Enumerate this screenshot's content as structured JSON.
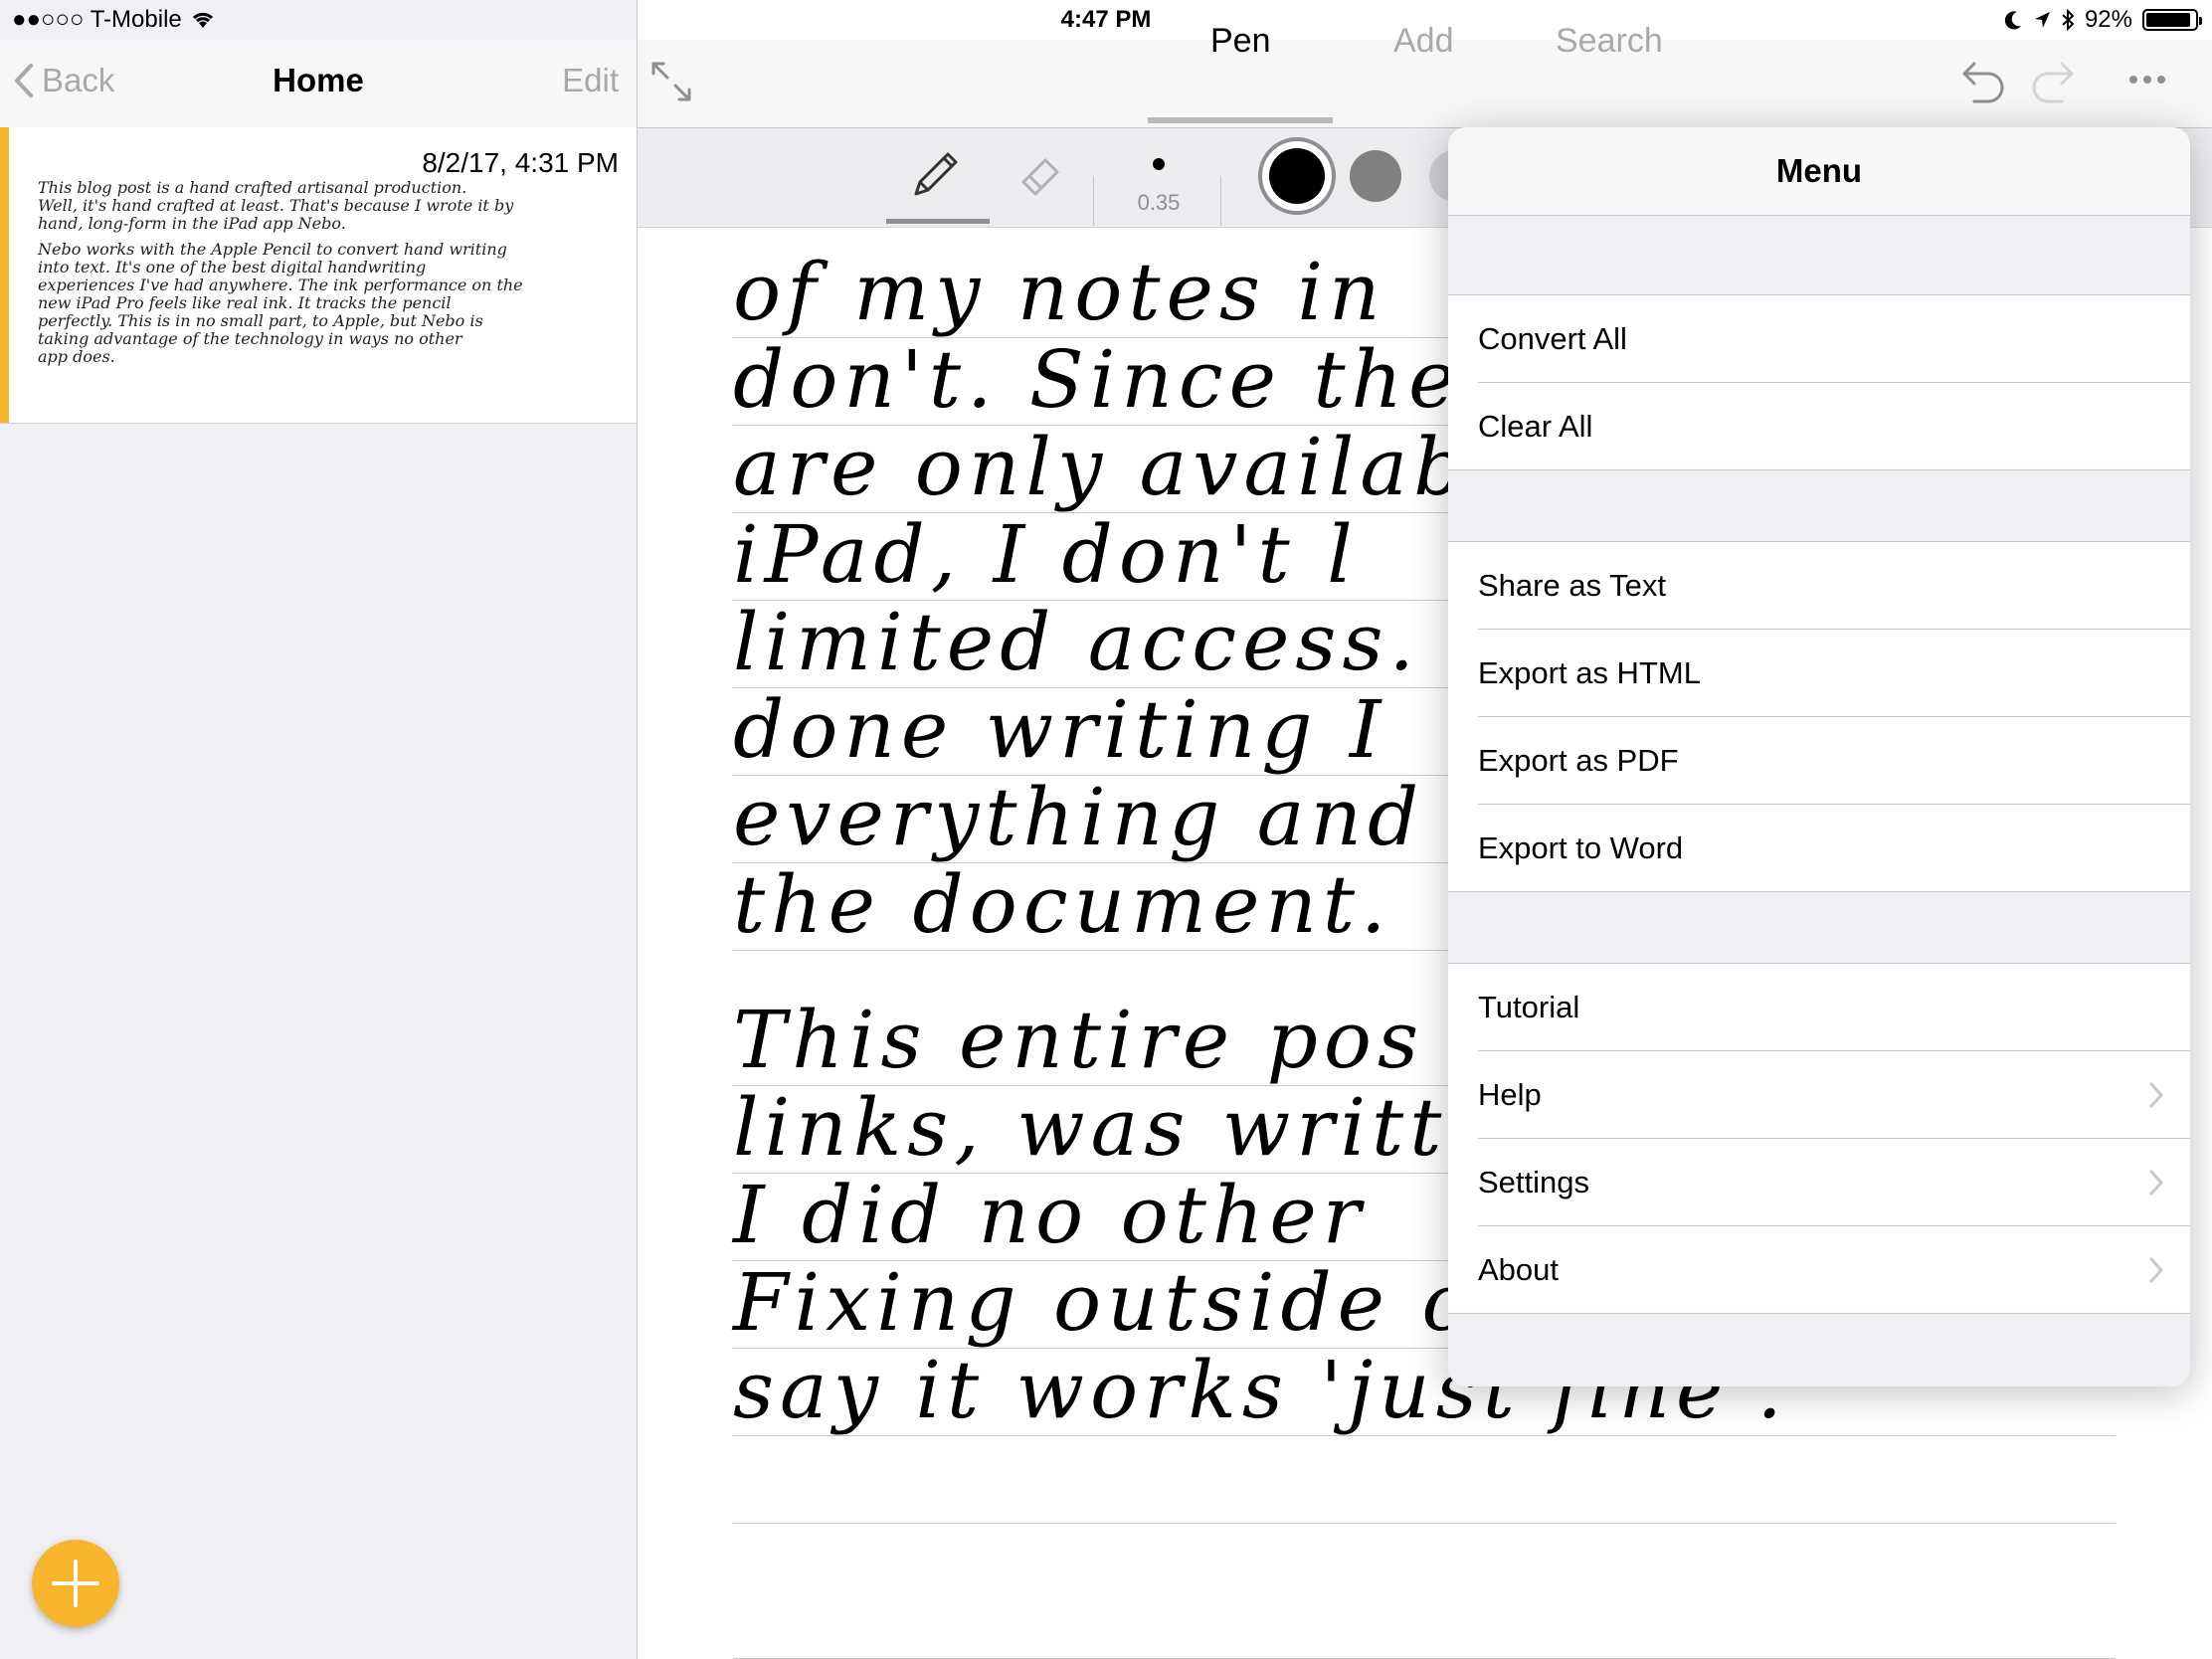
{
  "status_bar": {
    "carrier": "●●○○○ T-Mobile",
    "time": "4:47 PM",
    "battery": "92%",
    "battery_level": 0.92
  },
  "sidebar": {
    "back_label": "Back",
    "title": "Home",
    "edit_label": "Edit",
    "notes": [
      {
        "date": "8/2/17, 4:31 PM",
        "preview_lines": [
          "This blog post is a hand crafted artisanal production.",
          "Well, it's hand crafted at least. That's because I wrote it by",
          "hand, long-form in the iPad app Nebo.",
          "Nebo works with the Apple Pencil to convert hand writing",
          "into text. It's one of the best digital handwriting",
          "experiences I've had anywhere. The ink performance on the",
          "new iPad Pro feels like real ink. It tracks the pencil",
          "perfectly. This is in no small part, to Apple, but Nebo is",
          "taking advantage of the technology in ways no other",
          "app does."
        ]
      }
    ]
  },
  "main": {
    "tabs": [
      "Pen",
      "Add",
      "Search"
    ],
    "active_tab": "Pen",
    "pen_width": "0.35",
    "colors": [
      "#000000",
      "#808080",
      "#c8c8c8"
    ],
    "handwriting_lines": [
      "of my notes in",
      "don't. Since the",
      "are only availab",
      "iPad, I don't l",
      "limited access.",
      "done writing I",
      "everything and",
      "the document.",
      "",
      "This entire pos",
      "links, was writte",
      "I did no other",
      "Fixing outside of Nebo. I'd",
      "say it works 'just fine'."
    ]
  },
  "menu": {
    "title": "Menu",
    "groups": [
      [
        "Convert All",
        "Clear All"
      ],
      [
        "Share as Text",
        "Export as HTML",
        "Export as PDF",
        "Export to Word"
      ],
      [
        "Tutorial",
        "Help",
        "Settings",
        "About"
      ]
    ]
  },
  "accent_color": "#f7b52c"
}
